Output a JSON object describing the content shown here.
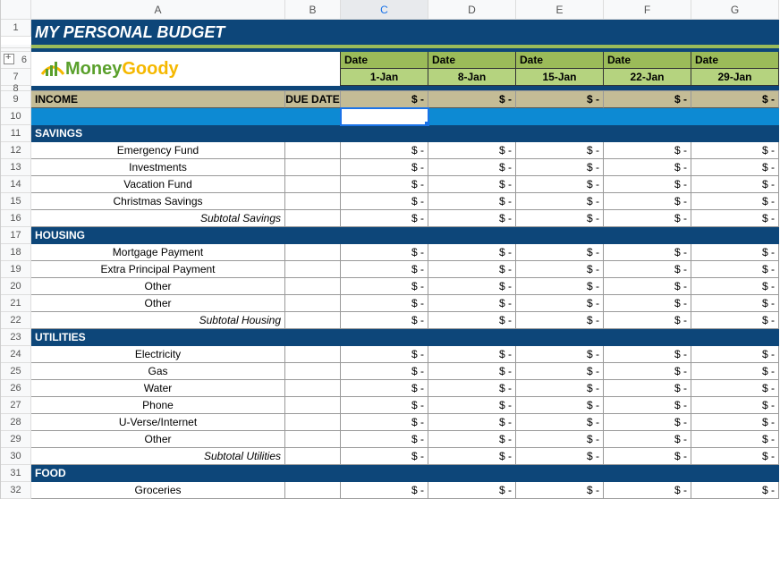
{
  "columns": [
    "A",
    "B",
    "C",
    "D",
    "E",
    "F",
    "G"
  ],
  "title": "MY PERSONAL BUDGET",
  "logo": {
    "money": "Money",
    "goody": "Goody"
  },
  "dateLabel": "Date",
  "dates": [
    "1-Jan",
    "8-Jan",
    "15-Jan",
    "22-Jan",
    "29-Jan"
  ],
  "dollar": "$ -",
  "incomeHeader": {
    "label": "INCOME",
    "due": "DUE DATE"
  },
  "rows": [
    {
      "num": "1",
      "type": "title"
    },
    {
      "num": "",
      "type": "stripe1"
    },
    {
      "num": "",
      "type": "stripe2"
    },
    {
      "num": "6",
      "type": "logo-top"
    },
    {
      "num": "7",
      "type": "logo-bot"
    },
    {
      "num": "8",
      "type": "darkthin"
    },
    {
      "num": "9",
      "type": "income"
    },
    {
      "num": "10",
      "type": "blue-selected"
    },
    {
      "num": "11",
      "type": "section",
      "label": "SAVINGS"
    },
    {
      "num": "12",
      "type": "item",
      "label": "Emergency Fund"
    },
    {
      "num": "13",
      "type": "item",
      "label": "Investments"
    },
    {
      "num": "14",
      "type": "item",
      "label": "Vacation Fund"
    },
    {
      "num": "15",
      "type": "item",
      "label": "Christmas Savings"
    },
    {
      "num": "16",
      "type": "subtotal",
      "label": "Subtotal Savings"
    },
    {
      "num": "17",
      "type": "section",
      "label": "HOUSING"
    },
    {
      "num": "18",
      "type": "item",
      "label": "Mortgage Payment"
    },
    {
      "num": "19",
      "type": "item",
      "label": "Extra Principal Payment"
    },
    {
      "num": "20",
      "type": "item",
      "label": "Other"
    },
    {
      "num": "21",
      "type": "item",
      "label": "Other"
    },
    {
      "num": "22",
      "type": "subtotal",
      "label": "Subtotal Housing"
    },
    {
      "num": "23",
      "type": "section",
      "label": "UTILITIES"
    },
    {
      "num": "24",
      "type": "item",
      "label": "Electricity"
    },
    {
      "num": "25",
      "type": "item",
      "label": "Gas"
    },
    {
      "num": "26",
      "type": "item",
      "label": "Water"
    },
    {
      "num": "27",
      "type": "item",
      "label": "Phone"
    },
    {
      "num": "28",
      "type": "item",
      "label": "U-Verse/Internet"
    },
    {
      "num": "29",
      "type": "item",
      "label": "Other"
    },
    {
      "num": "30",
      "type": "subtotal",
      "label": "Subtotal Utilities"
    },
    {
      "num": "31",
      "type": "section",
      "label": "FOOD"
    },
    {
      "num": "32",
      "type": "item",
      "label": "Groceries"
    }
  ],
  "activeColumn": "C"
}
